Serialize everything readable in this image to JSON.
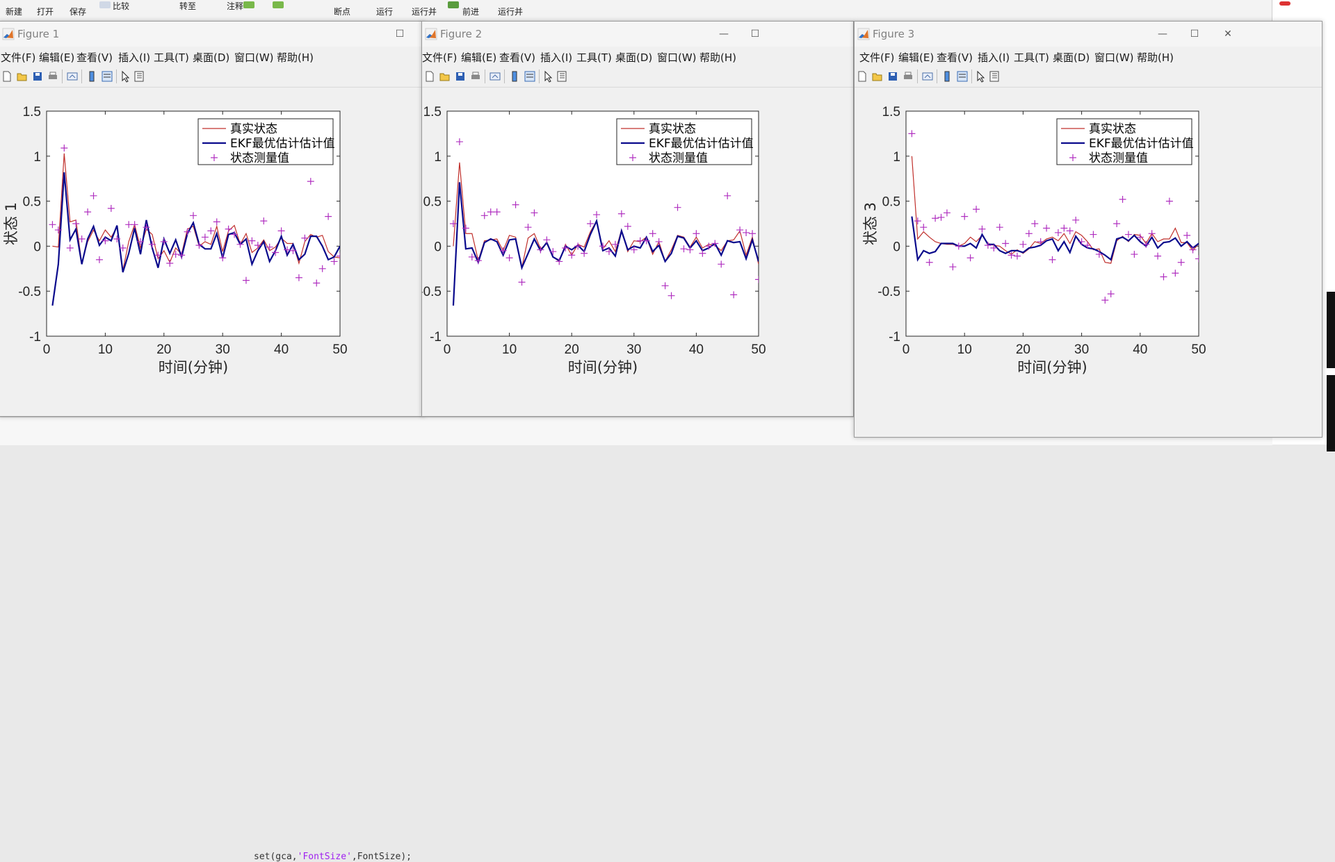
{
  "toolstrip": {
    "items": [
      "新建",
      "打开",
      "保存",
      "比较",
      "转至",
      "注释",
      "断点",
      "运行",
      "运行并",
      "前进",
      "运行并"
    ]
  },
  "background_code": {
    "prefix": "set(gca,",
    "str1": "'FontSize'",
    "sep": ",",
    "str2": "FontSize);"
  },
  "menus": [
    "文件(F)",
    "编辑(E)",
    "查看(V)",
    "插入(I)",
    "工具(T)",
    "桌面(D)",
    "窗口(W)",
    "帮助(H)"
  ],
  "colors": {
    "true_state": "#c0302c",
    "ekf_estimate": "#0a0a8c",
    "measurement": "#b030c0",
    "axes_bg": "#ffffff",
    "figure_bg": "#f0f0f0"
  },
  "figures": [
    {
      "title": "Figure 1",
      "chart_data": {
        "type": "line",
        "xlabel": "时间(分钟)",
        "ylabel": "状态 1",
        "xlim": [
          0,
          50
        ],
        "ylim": [
          -1,
          1.5
        ],
        "xticks": [
          "0",
          "10",
          "20",
          "30",
          "40",
          "50"
        ],
        "yticks": [
          "-1",
          "-0.5",
          "0",
          "0.5",
          "1",
          "1.5"
        ],
        "legend": [
          "真实状态",
          "EKF最优估计估计值",
          "状态测量值"
        ],
        "legend_position": "top-right",
        "x": [
          1,
          2,
          3,
          4,
          5,
          6,
          7,
          8,
          9,
          10,
          11,
          12,
          13,
          14,
          15,
          16,
          17,
          18,
          19,
          20,
          21,
          22,
          23,
          24,
          25,
          26,
          27,
          28,
          29,
          30,
          31,
          32,
          33,
          34,
          35,
          36,
          37,
          38,
          39,
          40,
          41,
          42,
          43,
          44,
          45,
          46,
          47,
          48,
          49,
          50
        ],
        "series": [
          {
            "name": "真实状态",
            "style": "line",
            "values": [
              0.0,
              -0.01,
              1.03,
              0.27,
              0.29,
              -0.19,
              0.05,
              0.18,
              0.06,
              0.18,
              0.1,
              0.21,
              -0.27,
              0.05,
              0.24,
              -0.02,
              0.19,
              0.13,
              -0.14,
              -0.05,
              -0.18,
              -0.02,
              -0.09,
              0.19,
              0.22,
              0.0,
              0.05,
              0.02,
              0.22,
              -0.06,
              0.17,
              0.23,
              0.02,
              0.14,
              -0.07,
              -0.02,
              0.07,
              -0.05,
              -0.01,
              0.09,
              0.03,
              0.03,
              -0.19,
              0.05,
              0.13,
              0.1,
              0.12,
              -0.06,
              -0.12,
              -0.13
            ]
          },
          {
            "name": "EKF最优估计估计值",
            "style": "line",
            "values": [
              -0.66,
              -0.2,
              0.82,
              0.07,
              0.19,
              -0.2,
              0.08,
              0.22,
              0.01,
              0.1,
              0.06,
              0.23,
              -0.29,
              -0.08,
              0.2,
              -0.09,
              0.29,
              -0.02,
              -0.24,
              0.08,
              -0.08,
              0.07,
              -0.12,
              0.14,
              0.26,
              0.02,
              -0.03,
              -0.03,
              0.14,
              -0.13,
              0.13,
              0.15,
              0.02,
              0.08,
              -0.2,
              -0.05,
              0.05,
              -0.17,
              -0.05,
              0.11,
              -0.1,
              0.02,
              -0.15,
              -0.09,
              0.11,
              0.11,
              0.0,
              -0.15,
              -0.12,
              0.0
            ]
          },
          {
            "name": "状态测量值",
            "style": "marker",
            "values": [
              0.24,
              0.18,
              1.09,
              -0.02,
              0.25,
              0.08,
              0.38,
              0.56,
              -0.15,
              0.06,
              0.42,
              0.08,
              -0.02,
              0.24,
              0.24,
              0.05,
              0.21,
              0.02,
              -0.1,
              0.05,
              -0.19,
              -0.09,
              -0.1,
              0.16,
              0.34,
              0.01,
              0.1,
              0.17,
              0.27,
              -0.13,
              0.19,
              0.13,
              0.02,
              -0.38,
              0.06,
              0.01,
              0.28,
              -0.01,
              -0.07,
              0.17,
              -0.04,
              -0.05,
              -0.35,
              0.09,
              0.72,
              -0.41,
              -0.25,
              0.33,
              -0.17,
              -0.11
            ]
          }
        ]
      }
    },
    {
      "title": "Figure 2",
      "chart_data": {
        "type": "line",
        "xlabel": "时间(分钟)",
        "ylabel": "状态 2",
        "xlim": [
          0,
          50
        ],
        "ylim": [
          -1,
          1.5
        ],
        "xticks": [
          "0",
          "10",
          "20",
          "30",
          "40",
          "50"
        ],
        "yticks": [
          "-1",
          "-0.5",
          "0",
          "0.5",
          "1",
          "1.5"
        ],
        "legend": [
          "真实状态",
          "EKF最优估计估计值",
          "状态测量值"
        ],
        "legend_position": "top-right",
        "x": [
          1,
          2,
          3,
          4,
          5,
          6,
          7,
          8,
          9,
          10,
          11,
          12,
          13,
          14,
          15,
          16,
          17,
          18,
          19,
          20,
          21,
          22,
          23,
          24,
          25,
          26,
          27,
          28,
          29,
          30,
          31,
          32,
          33,
          34,
          35,
          36,
          37,
          38,
          39,
          40,
          41,
          42,
          43,
          44,
          45,
          46,
          47,
          48,
          49,
          50
        ],
        "series": [
          {
            "name": "真实状态",
            "style": "line",
            "values": [
              0.0,
              0.93,
              0.14,
              0.14,
              -0.16,
              0.06,
              0.07,
              0.08,
              -0.05,
              0.12,
              0.1,
              -0.24,
              0.09,
              0.14,
              -0.03,
              0.03,
              -0.12,
              -0.17,
              0.02,
              -0.1,
              0.02,
              -0.01,
              0.16,
              0.28,
              -0.03,
              0.06,
              -0.06,
              0.18,
              -0.06,
              0.06,
              0.05,
              0.1,
              -0.09,
              0.05,
              -0.17,
              -0.04,
              0.12,
              0.1,
              -0.01,
              0.1,
              -0.02,
              0.02,
              0.01,
              -0.05,
              0.06,
              0.07,
              0.17,
              -0.1,
              0.1,
              -0.2
            ]
          },
          {
            "name": "EKF最优估计估计值",
            "style": "line",
            "values": [
              -0.66,
              0.71,
              -0.03,
              -0.02,
              -0.18,
              0.04,
              0.08,
              0.05,
              -0.1,
              0.07,
              0.08,
              -0.24,
              -0.08,
              0.08,
              -0.05,
              0.04,
              -0.12,
              -0.16,
              0.0,
              -0.04,
              0.01,
              -0.06,
              0.13,
              0.28,
              -0.05,
              -0.02,
              -0.11,
              0.17,
              -0.04,
              0.0,
              -0.02,
              0.1,
              -0.06,
              0.01,
              -0.17,
              -0.08,
              0.11,
              0.09,
              -0.02,
              0.06,
              -0.05,
              -0.02,
              0.03,
              -0.1,
              0.06,
              0.04,
              0.05,
              -0.14,
              0.07,
              -0.17
            ]
          },
          {
            "name": "状态测量值",
            "style": "marker",
            "values": [
              0.25,
              1.16,
              0.2,
              -0.12,
              -0.16,
              0.34,
              0.38,
              0.38,
              -0.05,
              -0.13,
              0.46,
              -0.4,
              0.21,
              0.37,
              -0.04,
              0.07,
              -0.06,
              -0.17,
              -0.02,
              -0.1,
              0.0,
              -0.08,
              0.25,
              0.35,
              0.0,
              -0.06,
              0.02,
              0.36,
              0.22,
              -0.04,
              0.06,
              0.06,
              0.14,
              0.05,
              -0.44,
              -0.55,
              0.43,
              -0.03,
              -0.04,
              0.14,
              -0.08,
              0.0,
              0.03,
              -0.2,
              0.56,
              -0.54,
              0.18,
              0.15,
              0.14,
              -0.37
            ]
          }
        ]
      }
    },
    {
      "title": "Figure 3",
      "chart_data": {
        "type": "line",
        "xlabel": "时间(分钟)",
        "ylabel": "状态 3",
        "xlim": [
          0,
          50
        ],
        "ylim": [
          -1,
          1.5
        ],
        "xticks": [
          "0",
          "10",
          "20",
          "30",
          "40",
          "50"
        ],
        "yticks": [
          "-1",
          "-0.5",
          "0",
          "0.5",
          "1",
          "1.5"
        ],
        "legend": [
          "真实状态",
          "EKF最优估计估计值",
          "状态测量值"
        ],
        "legend_position": "top-right",
        "x": [
          1,
          2,
          3,
          4,
          5,
          6,
          7,
          8,
          9,
          10,
          11,
          12,
          13,
          14,
          15,
          16,
          17,
          18,
          19,
          20,
          21,
          22,
          23,
          24,
          25,
          26,
          27,
          28,
          29,
          30,
          31,
          32,
          33,
          34,
          35,
          36,
          37,
          38,
          39,
          40,
          41,
          42,
          43,
          44,
          45,
          46,
          47,
          48,
          49,
          50
        ],
        "series": [
          {
            "name": "真实状态",
            "style": "line",
            "values": [
              1.0,
              0.08,
              0.16,
              0.1,
              0.05,
              0.03,
              0.02,
              0.02,
              0.0,
              0.03,
              0.1,
              0.05,
              0.12,
              0.03,
              0.01,
              0.0,
              -0.05,
              -0.09,
              -0.04,
              -0.08,
              -0.03,
              0.05,
              0.03,
              0.08,
              0.1,
              0.06,
              0.14,
              0.03,
              0.16,
              0.12,
              0.05,
              -0.04,
              -0.03,
              -0.18,
              -0.19,
              0.06,
              0.11,
              0.05,
              0.13,
              0.12,
              0.03,
              0.14,
              0.05,
              0.08,
              0.08,
              0.2,
              0.04,
              0.04,
              -0.05,
              0.03
            ]
          },
          {
            "name": "EKF最优估计估计值",
            "style": "line",
            "values": [
              0.33,
              -0.15,
              -0.05,
              -0.08,
              -0.06,
              0.03,
              0.03,
              0.03,
              0.0,
              0.0,
              0.03,
              -0.02,
              0.13,
              0.02,
              0.02,
              -0.05,
              -0.08,
              -0.05,
              -0.05,
              -0.07,
              -0.02,
              -0.01,
              0.01,
              0.06,
              0.08,
              -0.05,
              0.05,
              -0.07,
              0.11,
              0.02,
              -0.02,
              -0.03,
              -0.06,
              -0.1,
              -0.15,
              0.08,
              0.1,
              0.06,
              0.12,
              0.05,
              0.0,
              0.1,
              -0.02,
              0.04,
              0.05,
              0.09,
              0.0,
              0.05,
              -0.02,
              0.03
            ]
          },
          {
            "name": "状态测量值",
            "style": "marker",
            "values": [
              1.25,
              0.28,
              0.21,
              -0.18,
              0.31,
              0.32,
              0.37,
              -0.23,
              0.0,
              0.33,
              -0.13,
              0.41,
              0.19,
              0.01,
              -0.02,
              0.21,
              0.03,
              -0.1,
              -0.11,
              0.02,
              0.14,
              0.25,
              0.05,
              0.2,
              -0.15,
              0.15,
              0.2,
              0.17,
              0.29,
              0.05,
              0.01,
              0.13,
              -0.09,
              -0.6,
              -0.53,
              0.25,
              0.52,
              0.13,
              -0.09,
              0.1,
              0.02,
              0.14,
              -0.11,
              -0.34,
              0.5,
              -0.3,
              -0.18,
              0.12,
              -0.04,
              -0.14
            ]
          }
        ]
      }
    }
  ]
}
